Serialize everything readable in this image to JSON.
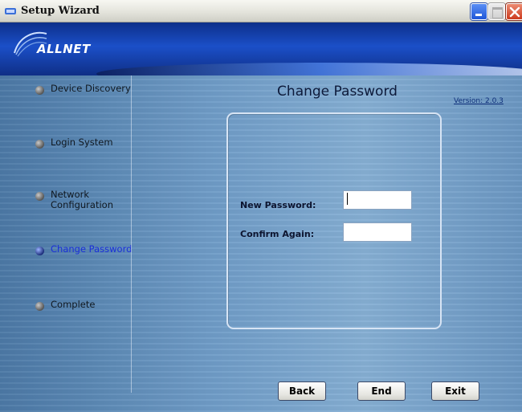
{
  "window": {
    "title": "Setup Wizard"
  },
  "banner": {
    "logo_text": "ALLNET"
  },
  "sidebar": {
    "items": [
      {
        "label": "Device Discovery",
        "active": false
      },
      {
        "label": "Login System",
        "active": false
      },
      {
        "label": "Network Configuration",
        "active": false
      },
      {
        "label": "Change Password",
        "active": true
      },
      {
        "label": "Complete",
        "active": false
      }
    ]
  },
  "main": {
    "title": "Change Password",
    "version": "Version: 2.0.3",
    "form": {
      "new_password_label": "New Password:",
      "new_password_value": "",
      "confirm_label": "Confirm Again:",
      "confirm_value": ""
    }
  },
  "buttons": {
    "back": "Back",
    "end": "End",
    "exit": "Exit"
  },
  "colors": {
    "banner": "#1b4fc8",
    "active_nav": "#1a2fd9",
    "background": "#6f9cc7"
  }
}
